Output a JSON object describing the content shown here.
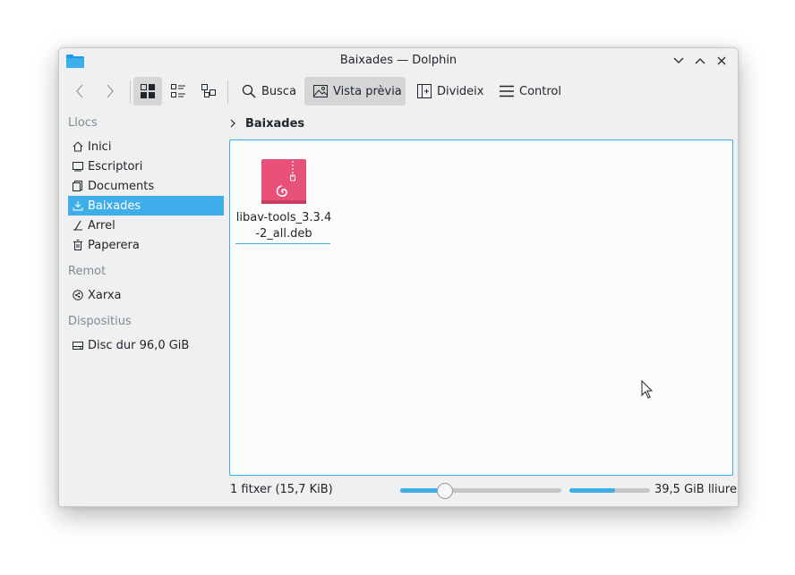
{
  "window": {
    "title": "Baixades — Dolphin"
  },
  "toolbar": {
    "search_label": "Busca",
    "preview_label": "Vista prèvia",
    "split_label": "Divideix",
    "control_label": "Control"
  },
  "sidebar": {
    "sections": [
      {
        "title": "Llocs"
      },
      {
        "title": "Remot"
      },
      {
        "title": "Dispositius"
      }
    ],
    "places": [
      {
        "label": "Inici",
        "icon": "home-icon"
      },
      {
        "label": "Escriptori",
        "icon": "desktop-icon"
      },
      {
        "label": "Documents",
        "icon": "documents-icon"
      },
      {
        "label": "Baixades",
        "icon": "downloads-icon",
        "selected": true
      },
      {
        "label": "Arrel",
        "icon": "root-icon"
      },
      {
        "label": "Paperera",
        "icon": "trash-icon"
      }
    ],
    "remote": [
      {
        "label": "Xarxa",
        "icon": "network-icon"
      }
    ],
    "devices": [
      {
        "label": "Disc dur 96,0 GiB",
        "icon": "harddisk-icon"
      }
    ]
  },
  "breadcrumb": {
    "current": "Baixades"
  },
  "files": [
    {
      "name": "libav-tools_3.3.4-2_all.deb",
      "icon": "debian-package-icon"
    }
  ],
  "status": {
    "summary": "1 fitxer (15,7 KiB)",
    "zoom_fraction": 0.27,
    "space_used_fraction": 0.57,
    "free_space": "39,5 GiB lliure"
  },
  "colors": {
    "accent": "#3daee9",
    "window_bg": "#eff0f1",
    "view_bg": "#fcfcfc",
    "package_icon": "#e8517a"
  }
}
